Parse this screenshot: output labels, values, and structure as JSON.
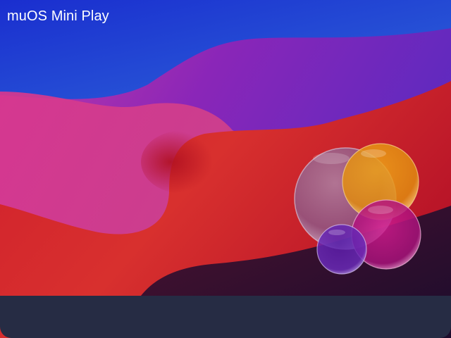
{
  "header": {
    "title": "muOS Mini Play"
  },
  "wallpaper": {
    "description_icon": "bubbles-wallpaper",
    "colors": {
      "sky_top": "#1f37d4",
      "sky_light": "#3d9be0",
      "wave_purple": "#7a25b8",
      "wave_magenta": "#d23a9a",
      "wave_red": "#d61f2a",
      "dark_shadow": "#241034",
      "bubble_blue": "#6b8cc8",
      "bubble_orange": "#e6910f",
      "bubble_magenta": "#c0188a",
      "bubble_purple": "#5a1ea8"
    }
  },
  "bottom_bar": {
    "color": "#262c44"
  }
}
